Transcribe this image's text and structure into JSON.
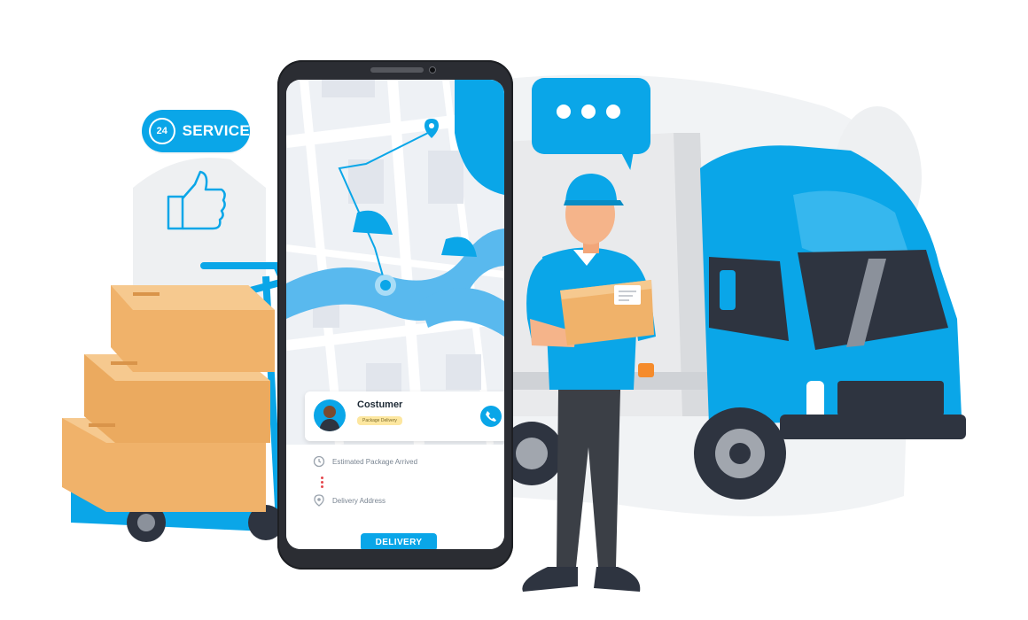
{
  "service_badge": {
    "hours": "24",
    "label": "SERVICE"
  },
  "phone_app": {
    "customer": {
      "name": "Costumer",
      "tag": "Package Delivery"
    },
    "info": {
      "estimated_label": "Estimated Package Arrived",
      "address_label": "Delivery Address"
    },
    "delivery_button": "DELIVERY"
  },
  "colors": {
    "accent": "#0AA6E8",
    "truck_dark": "#2E3440",
    "box": "#F0B26A"
  },
  "icons": {
    "clock": "clock-icon",
    "location": "location-pin-icon",
    "phone": "phone-icon",
    "chat": "chat-bubble-icon",
    "like": "thumbs-up-icon"
  }
}
